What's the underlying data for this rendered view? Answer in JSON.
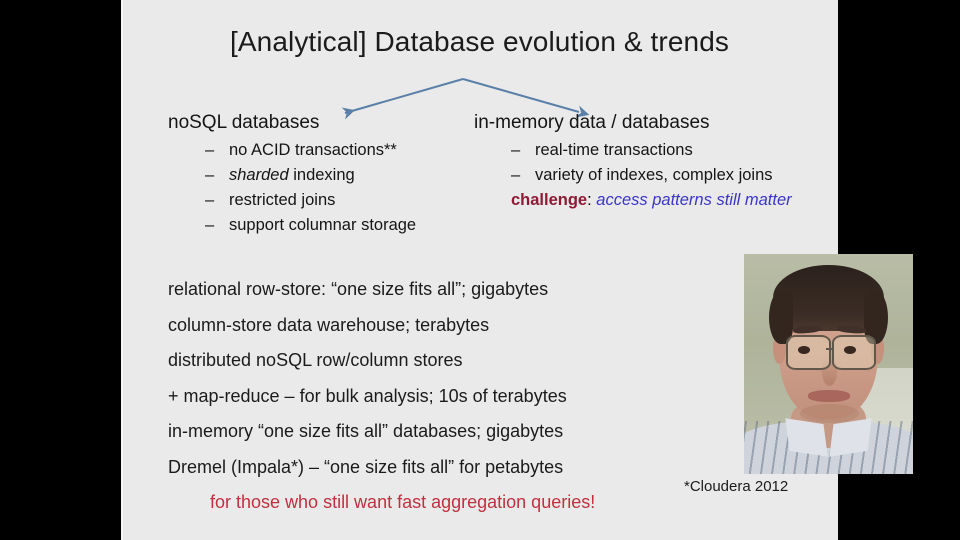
{
  "slide": {
    "title": "[Analytical] Database evolution & trends",
    "columns": [
      {
        "heading": "noSQL databases",
        "bullets": [
          {
            "dash": "–",
            "text": "no ACID transactions**"
          },
          {
            "dash": "–",
            "pre": "sharded",
            "text": " indexing",
            "italic_lead": true
          },
          {
            "dash": "–",
            "text": "restricted joins"
          },
          {
            "dash": "–",
            "text": "support columnar storage"
          }
        ]
      },
      {
        "heading": "in-memory data / databases",
        "bullets": [
          {
            "dash": "–",
            "text": "real-time transactions"
          },
          {
            "dash": "–",
            "text": "variety of indexes, complex joins"
          }
        ],
        "challenge_label": "challenge",
        "challenge_sep": ": ",
        "challenge_value": "access patterns still matter"
      }
    ],
    "lower_lines": [
      "relational row-store: “one size fits all”; gigabytes",
      "column-store data warehouse; terabytes",
      "distributed noSQL row/column stores",
      "+ map-reduce – for bulk analysis; 10s of terabytes",
      "in-memory “one size fits all” databases; gigabytes",
      "Dremel (Impala*) – “one size fits all” for petabytes"
    ],
    "punchline": "for those who still want fast aggregation queries!",
    "footnote": "*Cloudera 2012"
  },
  "webcam": {
    "label": "presenter-video"
  },
  "colors": {
    "slide_background": "#eaeaea",
    "body_text": "#1b1b1b",
    "arrow": "#5a7fa8",
    "challenge_label": "#8e1b36",
    "challenge_value": "#3b35c8",
    "punchline": "#c2303f",
    "letterbox": "#000000"
  }
}
